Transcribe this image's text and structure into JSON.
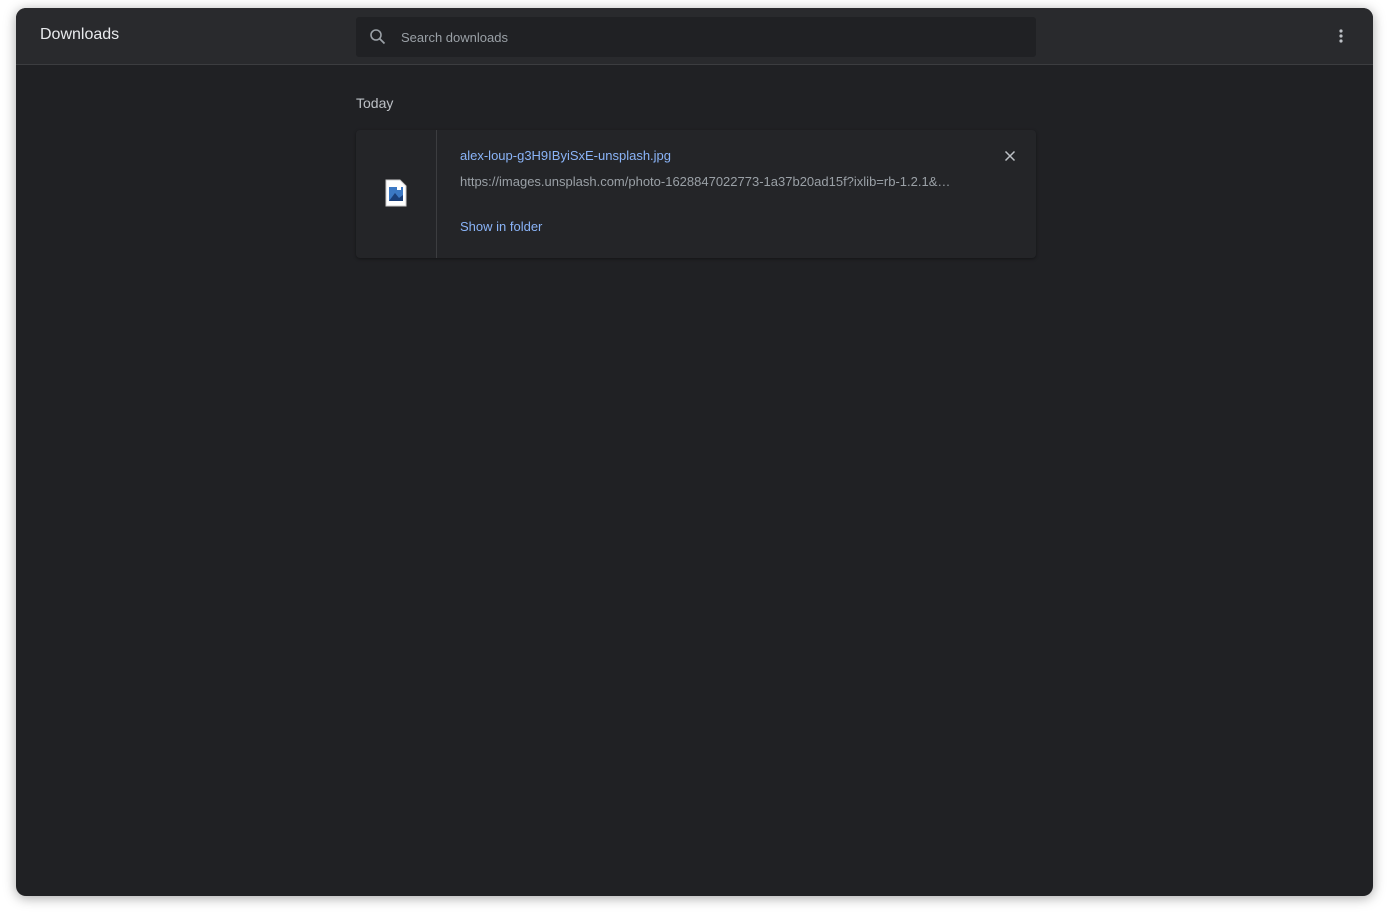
{
  "header": {
    "title": "Downloads",
    "search_placeholder": "Search downloads",
    "search_value": ""
  },
  "section": {
    "label": "Today"
  },
  "downloads": [
    {
      "filename": "alex-loup-g3H9IByiSxE-unsplash.jpg",
      "url": "https://images.unsplash.com/photo-1628847022773-1a37b20ad15f?ixlib=rb-1.2.1&…",
      "action": "Show in folder",
      "file_icon": "image-file-icon"
    }
  ],
  "colors": {
    "background": "#202124",
    "header": "#292a2d",
    "link": "#8ab4f8"
  }
}
